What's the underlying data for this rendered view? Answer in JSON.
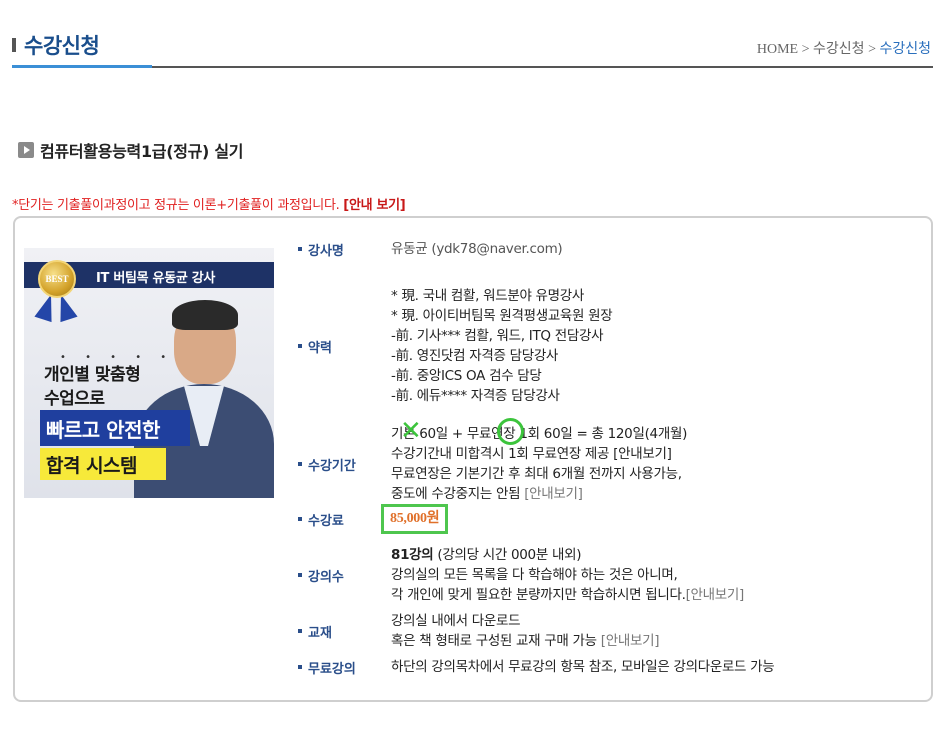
{
  "header": {
    "title": "수강신청",
    "breadcrumb": {
      "home": "HOME",
      "sep1": " > ",
      "parent": "수강신청",
      "sep2": " > ",
      "current": "수강신청"
    }
  },
  "course": {
    "title": "컴퓨터활용능력1급(정규) 실기"
  },
  "notice": {
    "text": "*단기는 기출풀이과정이고 정규는 이론+기출풀이 과정입니다. ",
    "link": "[안내 보기]"
  },
  "banner": {
    "badge": "BEST",
    "strip": "IT 버팀목 유동균 강사",
    "dots": "• • • • •",
    "line1": "개인별 맞춤형",
    "line2": "수업으로",
    "box1": "빠르고 안전한",
    "box2": "합격 시스템"
  },
  "info": {
    "instructor": {
      "label": "강사명",
      "value": "유동균 (ydk78@naver.com)"
    },
    "career": {
      "label": "약력",
      "lines": [
        "* 現. 국내 컴활, 워드분야 유명강사",
        "* 現. 아이티버팀목 원격평생교육원 원장",
        "-前. 기사*** 컴활, 워드, ITQ 전담강사",
        "-前. 영진닷컴 자격증 담당강사",
        "-前. 중앙ICS OA 검수 담당",
        "-前. 에듀**** 자격증 담당강사"
      ]
    },
    "period": {
      "label": "수강기간",
      "line1": "기본 60일 + 무료연장 1회 60일 = 총 120일(4개월)",
      "line2_text": "수강기간내 미합격시 1회 무료연장 제공 ",
      "line2_link": "[안내보기]",
      "line3": "무료연장은 기본기간 후 최대 6개월 전까지 사용가능,",
      "line4_text": "중도에 수강중지는 안됨 ",
      "line4_link": "[안내보기]"
    },
    "fee": {
      "label": "수강료",
      "value": "85,000원"
    },
    "lectures": {
      "label": "강의수",
      "count": "81강의",
      "count_note": " (강의당 시간 000분 내외)",
      "line2": "강의실의 모든 목록을 다 학습해야 하는 것은 아니며,",
      "line3_text": "각 개인에 맞게 필요한 분량까지만 학습하시면 됩니다.",
      "line3_link": "[안내보기]"
    },
    "textbook": {
      "label": "교재",
      "line1": "강의실 내에서 다운로드",
      "line2_text": "혹은 책 형태로 구성된 교재 구매 가능 ",
      "line2_link": "[안내보기]"
    },
    "free": {
      "label": "무료강의",
      "value": "하단의 강의목차에서 무료강의 항목 참조, 모바일은 강의다운로드 가능"
    }
  },
  "colors": {
    "accent": "#1a4e8c",
    "fee": "#e0702a",
    "highlight": "#4ec64e",
    "notice": "#e02020"
  }
}
